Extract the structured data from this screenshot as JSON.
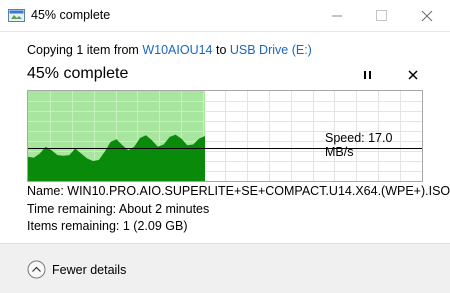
{
  "window": {
    "title": "45% complete",
    "icons": {
      "app": "file-copy-icon",
      "minimize": "minimize-icon",
      "maximize": "maximize-icon",
      "close": "close-icon"
    }
  },
  "copy": {
    "prefix": "Copying 1 item from ",
    "source": "W10AIOU14",
    "middle": " to ",
    "destination": "USB Drive (E:)"
  },
  "progress": {
    "heading": "45% complete",
    "percent": 45,
    "speed_text": "Speed: 17.0 MB/s",
    "pause_icon": "pause-icon",
    "cancel_icon": "close-icon"
  },
  "details": {
    "name": "Name:  WIN10.PRO.AIO.SUPERLITE+SE+COMPACT.U14.X64.(WPE+).ISO",
    "time": "Time remaining:  About 2 minutes",
    "items": "Items remaining:  1 (2.09 GB)"
  },
  "footer": {
    "toggle_label": "Fewer details",
    "toggle_icon": "chevron-up-circle-icon"
  },
  "colors": {
    "progress_fill": "#a8e6a0",
    "speed_fill": "#0a8a0a",
    "link": "#1a66c2",
    "footer_bg": "#f0f0f0"
  }
}
